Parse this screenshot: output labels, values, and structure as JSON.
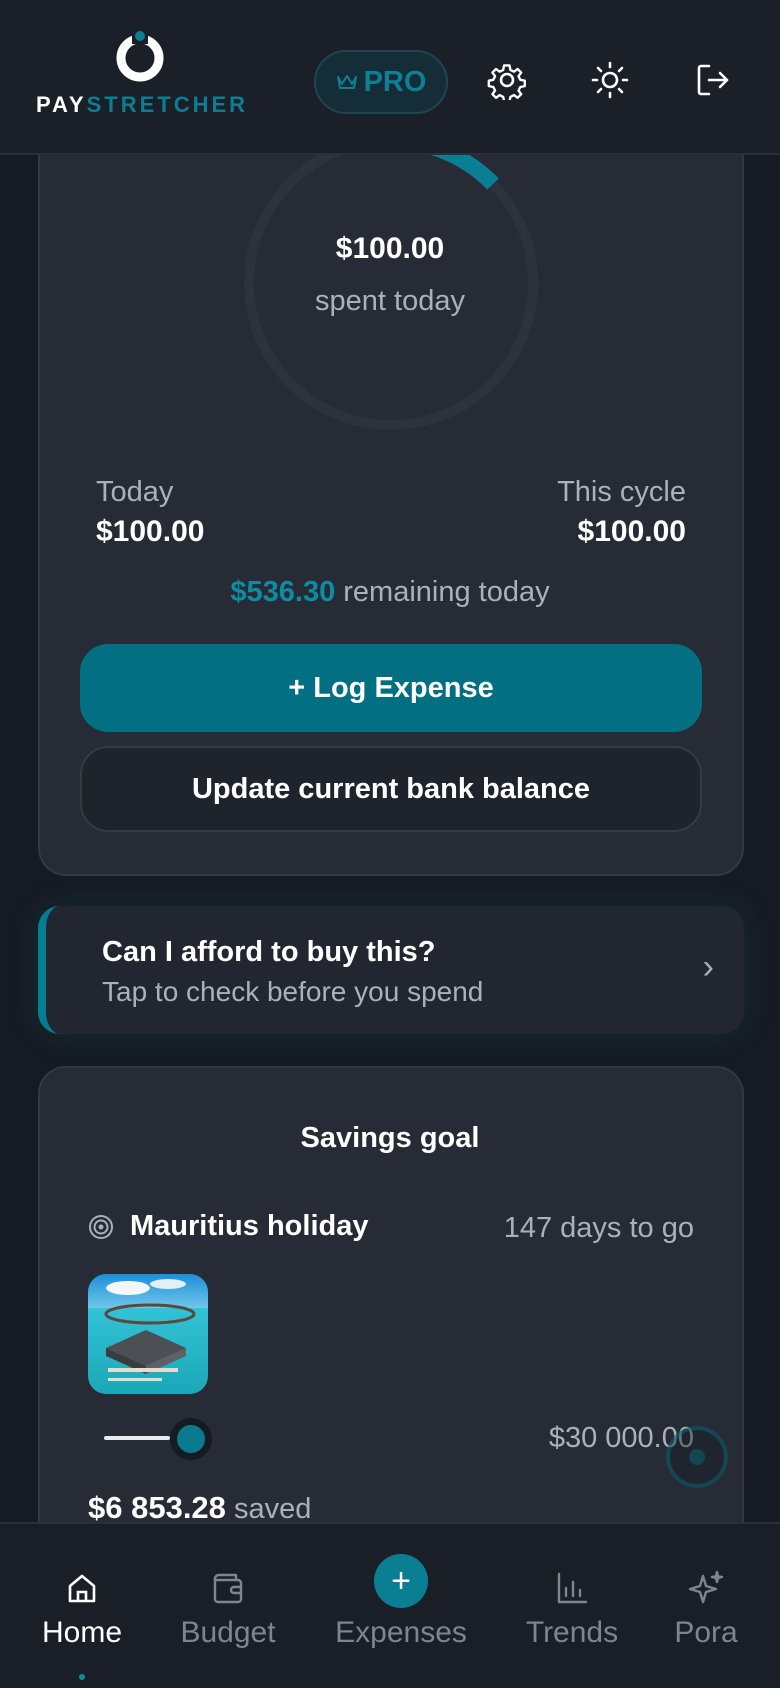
{
  "header": {
    "logo": {
      "part1": "PAY",
      "part2": "STRETCHER"
    },
    "pro_label": "PRO",
    "icons": [
      "settings-gear-icon",
      "sun-theme-icon",
      "logout-icon"
    ]
  },
  "summary": {
    "spent_amount": "$100.00",
    "spent_label": "spent today",
    "today_label": "Today",
    "today_value": "$100.00",
    "cycle_label": "This cycle",
    "cycle_value": "$100.00",
    "remaining_amount": "$536.30",
    "remaining_label": "remaining today",
    "log_expense_label": "+ Log Expense",
    "update_balance_label": "Update current bank balance"
  },
  "afford": {
    "title": "Can I afford to buy this?",
    "subtitle": "Tap to check before you spend",
    "chevron": "›"
  },
  "savings": {
    "title": "Savings goal",
    "goal_name": "Mauritius holiday",
    "days_to_go": "147 days to go",
    "target": "$30 000.00",
    "saved_amount": "$6 853.28",
    "saved_label": "saved"
  },
  "nav": {
    "items": [
      {
        "label": "Home",
        "icon": "home-icon",
        "active": true
      },
      {
        "label": "Budget",
        "icon": "wallet-icon",
        "active": false
      },
      {
        "label": "Expenses",
        "icon": "plus-icon",
        "active": false
      },
      {
        "label": "Trends",
        "icon": "bar-chart-icon",
        "active": false
      },
      {
        "label": "Pora",
        "icon": "sparkle-icon",
        "active": false
      }
    ]
  },
  "colors": {
    "accent": "#036f82",
    "accent_text": "#0b8da3",
    "background": "#161b23",
    "card": "#262b35"
  }
}
